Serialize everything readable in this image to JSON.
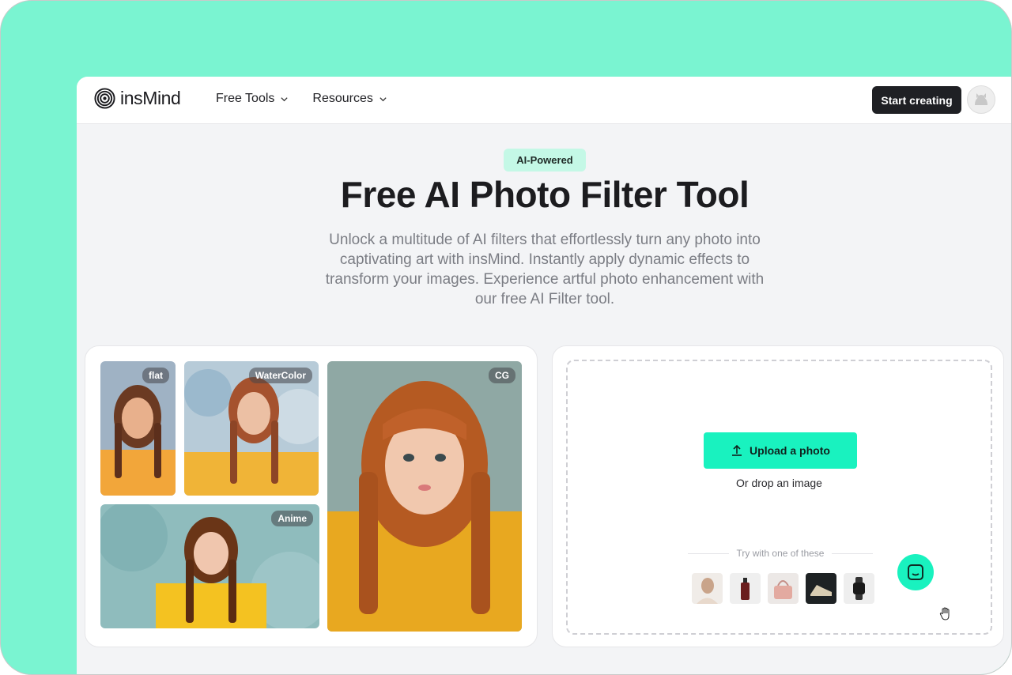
{
  "header": {
    "logo_text": "insMind",
    "nav": [
      {
        "label": "Free Tools"
      },
      {
        "label": "Resources"
      }
    ],
    "cta_label": "Start creating"
  },
  "hero": {
    "badge": "AI-Powered",
    "title": "Free AI Photo Filter Tool",
    "subtitle": "Unlock a multitude of AI filters that effortlessly turn any photo into captivating art with insMind. Instantly apply dynamic effects to transform your images. Experience artful photo enhancement with our free AI Filter tool."
  },
  "gallery": {
    "tags": [
      "flat",
      "WaterColor",
      "CG",
      "Anime"
    ]
  },
  "upload": {
    "button_label": "Upload a photo",
    "drop_text": "Or drop an image",
    "try_text": "Try with one of these",
    "samples": [
      "sample-portrait",
      "sample-bottle",
      "sample-handbag",
      "sample-shoe",
      "sample-watch"
    ]
  },
  "colors": {
    "accent": "#19f2bf",
    "frame": "#7af4d1",
    "dark": "#1f2024"
  }
}
